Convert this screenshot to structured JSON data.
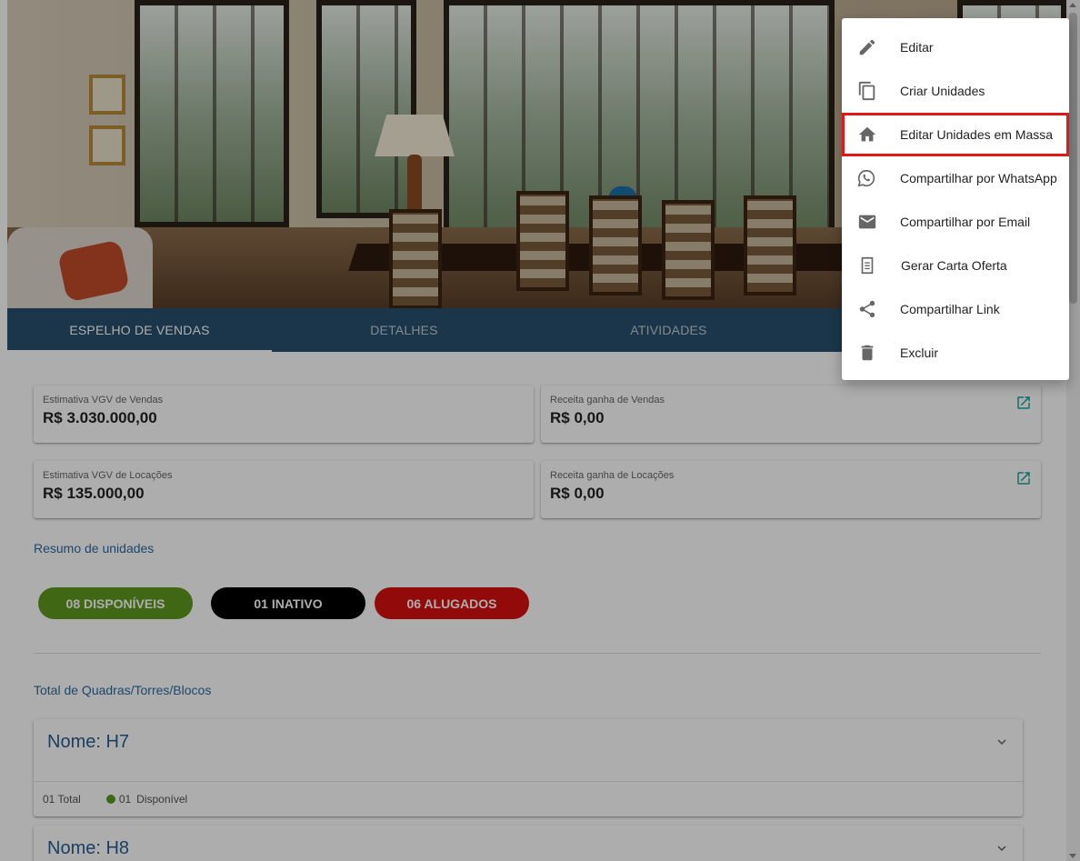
{
  "tabs": [
    {
      "label": "ESPELHO DE VENDAS",
      "active": true
    },
    {
      "label": "DETALHES",
      "active": false
    },
    {
      "label": "ATIVIDADES",
      "active": false
    },
    {
      "label": "",
      "active": false
    }
  ],
  "stats": [
    {
      "label": "Estimativa VGV de Vendas",
      "value": "R$ 3.030.000,00",
      "has_link": false
    },
    {
      "label": "Receita ganha de Vendas",
      "value": "R$ 0,00",
      "has_link": true
    },
    {
      "label": "Estimativa VGV de Locações",
      "value": "R$ 135.000,00",
      "has_link": false
    },
    {
      "label": "Receita ganha de Locações",
      "value": "R$ 0,00",
      "has_link": true
    }
  ],
  "summary": {
    "title": "Resumo de unidades",
    "pills": [
      {
        "label": "08 DISPONÍVEIS",
        "color": "#5f9a1e"
      },
      {
        "label": "01 INATIVO",
        "color": "#000000"
      },
      {
        "label": "06 ALUGADOS",
        "color": "#d80f0f"
      }
    ]
  },
  "blocks": {
    "title": "Total de Quadras/Torres/Blocos",
    "items": [
      {
        "name": "Nome: H7",
        "total": "01 Total",
        "available_count": "01",
        "available_label": "Disponível"
      },
      {
        "name": "Nome: H8"
      }
    ]
  },
  "menu": {
    "items": [
      {
        "label": "Editar",
        "icon": "pencil-icon"
      },
      {
        "label": "Criar Unidades",
        "icon": "copy-icon"
      },
      {
        "label": "Editar Unidades em Massa",
        "icon": "home-icon",
        "highlighted": true
      },
      {
        "label": "Compartilhar por WhatsApp",
        "icon": "whatsapp-icon"
      },
      {
        "label": "Compartilhar por Email",
        "icon": "email-icon"
      },
      {
        "label": "Gerar Carta Oferta",
        "icon": "document-icon"
      },
      {
        "label": "Compartilhar Link",
        "icon": "share-icon"
      },
      {
        "label": "Excluir",
        "icon": "trash-icon"
      }
    ]
  },
  "colors": {
    "tab_bar": "#29506e",
    "accent_text": "#2d6aa0",
    "highlight_border": "#e01818",
    "link_icon": "#1aa39a"
  }
}
